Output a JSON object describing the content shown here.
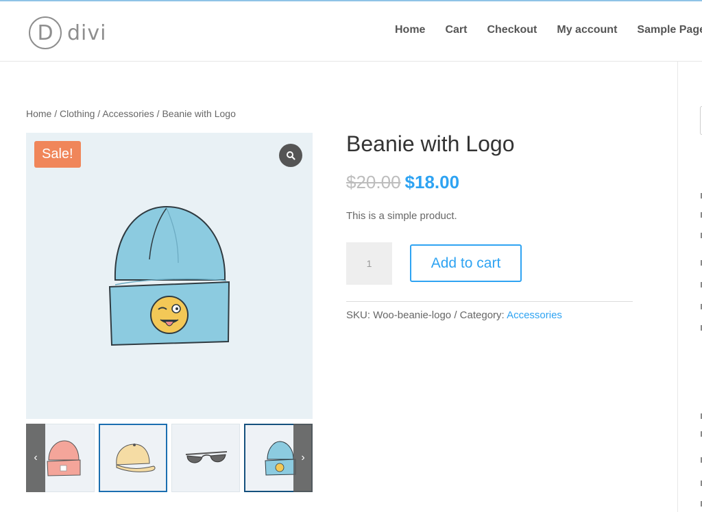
{
  "site": {
    "logo_letter": "D",
    "logo_text": "divi"
  },
  "nav": [
    {
      "label": "Home"
    },
    {
      "label": "Cart"
    },
    {
      "label": "Checkout"
    },
    {
      "label": "My account"
    },
    {
      "label": "Sample Page"
    }
  ],
  "breadcrumb": {
    "items": [
      "Home",
      "Clothing",
      "Accessories"
    ],
    "separator": " / ",
    "current": "Beanie with Logo"
  },
  "gallery": {
    "sale_badge": "Sale!",
    "zoom_icon": "magnifier-icon",
    "prev_icon": "chevron-left-icon",
    "next_icon": "chevron-right-icon",
    "prev_glyph": "‹",
    "next_glyph": "›",
    "thumbnails": [
      "pink-beanie",
      "cap",
      "sunglasses",
      "blue-beanie-with-logo"
    ],
    "selected_thumbnail": "blue-beanie-with-logo"
  },
  "product": {
    "title": "Beanie with Logo",
    "regular_price": "$20.00",
    "sale_price": "$18.00",
    "short_description": "This is a simple product.",
    "quantity": "1",
    "add_to_cart_label": "Add to cart",
    "sku_label": "SKU:",
    "sku": "Woo-beanie-logo",
    "category_label": "Category:",
    "category": "Accessories",
    "meta_separator": " / "
  },
  "colors": {
    "accent": "#2ea3f2",
    "sale_badge": "#f0865a",
    "beanie": "#8ccbe0",
    "thumb_border_selected": "#1a6eb0"
  }
}
